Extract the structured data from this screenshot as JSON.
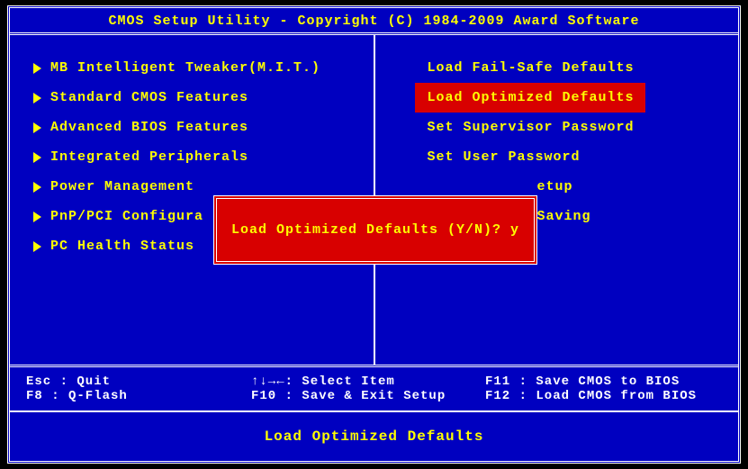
{
  "header": "CMOS Setup Utility - Copyright (C) 1984-2009 Award Software",
  "menu": {
    "left": [
      "MB Intelligent Tweaker(M.I.T.)",
      "Standard CMOS Features",
      "Advanced BIOS Features",
      "Integrated Peripherals",
      "Power Management",
      "PnP/PCI Configura",
      "PC Health Status"
    ],
    "right": [
      "Load Fail-Safe Defaults",
      "Load Optimized Defaults",
      "Set Supervisor Password",
      "Set User Password",
      "etup",
      "Saving"
    ],
    "highlighted_index": 1
  },
  "dialog": {
    "text": "Load Optimized Defaults (Y/N)? y"
  },
  "keys": {
    "row1": {
      "esc": "Esc : Quit",
      "arrows": "↑↓→←: Select Item",
      "f11": "F11 : Save CMOS to BIOS"
    },
    "row2": {
      "f8": "F8  : Q-Flash",
      "f10": "F10 : Save & Exit Setup",
      "f12": "F12 : Load CMOS from BIOS"
    }
  },
  "footer_desc": "Load Optimized Defaults"
}
